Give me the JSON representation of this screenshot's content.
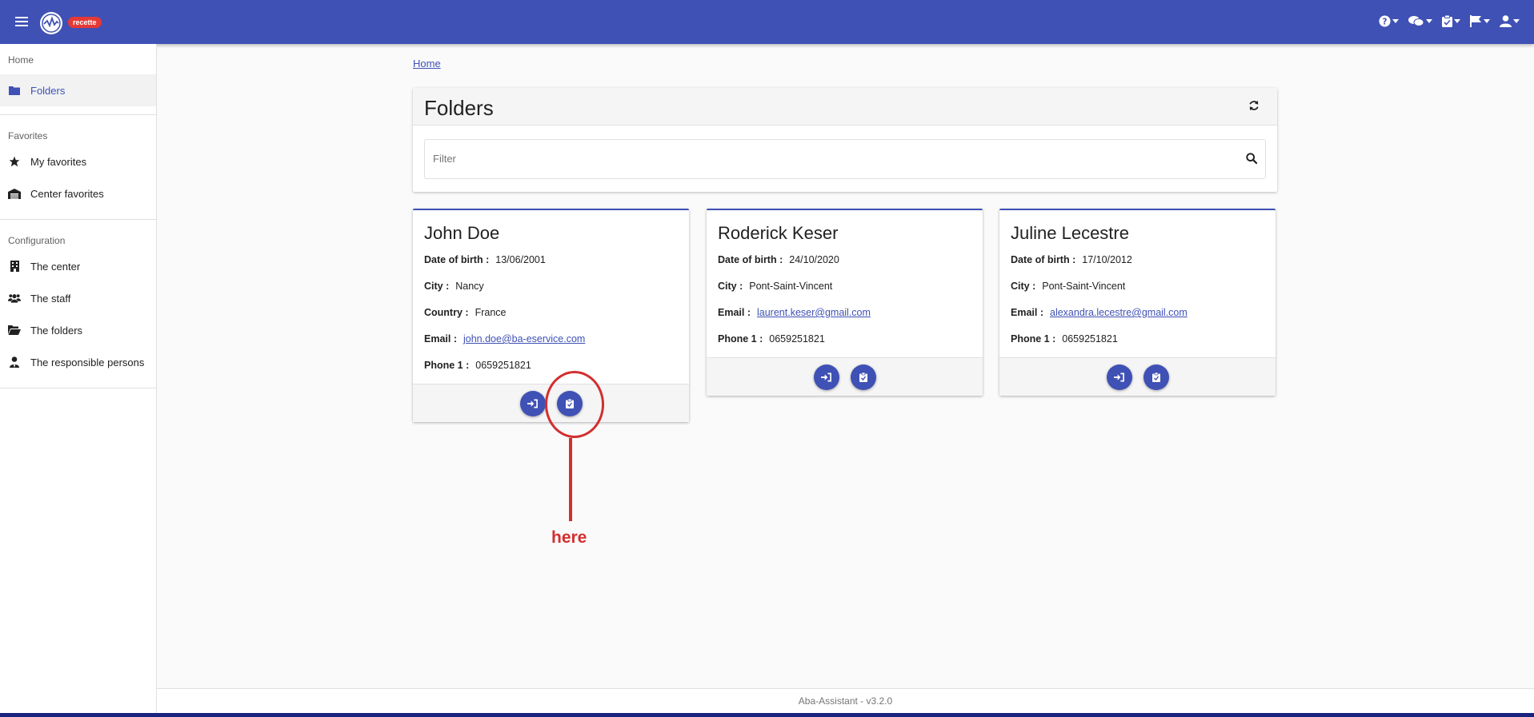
{
  "header": {
    "badge": "recette",
    "brand_color": "#3f51b5",
    "icons": [
      "help-icon",
      "chat-icon",
      "clipboard-icon",
      "flag-icon",
      "user-icon"
    ]
  },
  "sidebar": {
    "sections": [
      {
        "title": "Home",
        "items": [
          {
            "label": "Folders",
            "icon": "folder-icon",
            "active": true
          }
        ]
      },
      {
        "title": "Favorites",
        "items": [
          {
            "label": "My favorites",
            "icon": "star-icon"
          },
          {
            "label": "Center favorites",
            "icon": "warehouse-icon"
          }
        ]
      },
      {
        "title": "Configuration",
        "items": [
          {
            "label": "The center",
            "icon": "building-icon"
          },
          {
            "label": "The staff",
            "icon": "users-icon"
          },
          {
            "label": "The folders",
            "icon": "folder-open-icon"
          },
          {
            "label": "The responsible persons",
            "icon": "user-tie-icon"
          }
        ]
      }
    ]
  },
  "breadcrumb": "Home",
  "panel": {
    "title": "Folders",
    "filter_placeholder": "Filter"
  },
  "cards": [
    {
      "name": "John Doe",
      "fields": [
        {
          "label": "Date of birth :",
          "value": "13/06/2001"
        },
        {
          "label": "City :",
          "value": "Nancy"
        },
        {
          "label": "Country :",
          "value": "France"
        },
        {
          "label": "Email :",
          "value": "john.doe@ba-eservice.com",
          "link": true
        },
        {
          "label": "Phone 1 :",
          "value": "0659251821"
        }
      ]
    },
    {
      "name": "Roderick Keser",
      "fields": [
        {
          "label": "Date of birth :",
          "value": "24/10/2020"
        },
        {
          "label": "City :",
          "value": "Pont-Saint-Vincent"
        },
        {
          "label": "Email :",
          "value": "laurent.keser@gmail.com",
          "link": true
        },
        {
          "label": "Phone 1 :",
          "value": "0659251821"
        }
      ]
    },
    {
      "name": "Juline Lecestre",
      "fields": [
        {
          "label": "Date of birth :",
          "value": "17/10/2012"
        },
        {
          "label": "City :",
          "value": "Pont-Saint-Vincent"
        },
        {
          "label": "Email :",
          "value": "alexandra.lecestre@gmail.com",
          "link": true
        },
        {
          "label": "Phone 1 :",
          "value": "0659251821"
        }
      ]
    }
  ],
  "annotation": {
    "text": "here",
    "color": "#d32f2f"
  },
  "footer": "Aba-Assistant - v3.2.0"
}
